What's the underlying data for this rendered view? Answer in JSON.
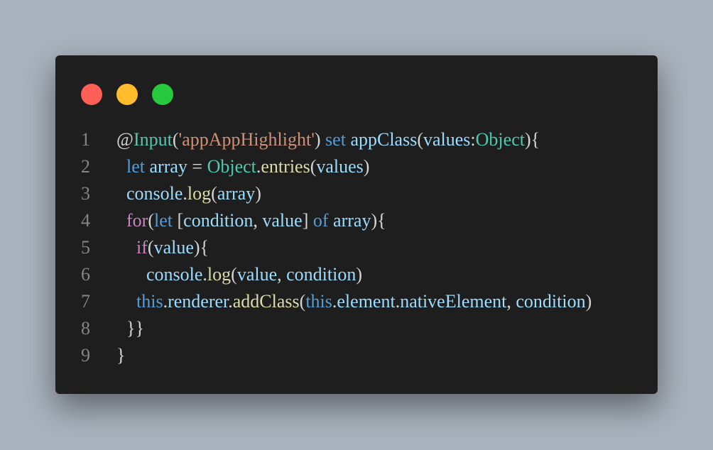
{
  "window": {
    "lights": [
      {
        "name": "close",
        "color": "#ff5f56"
      },
      {
        "name": "minimize",
        "color": "#ffbd2e"
      },
      {
        "name": "zoom",
        "color": "#27c93f"
      }
    ]
  },
  "colors": {
    "background": "#a9b3bd",
    "editor": "#1e1e1e",
    "plain": "#d4d4d4",
    "line_number": "#858585",
    "keyword": "#569cd6",
    "control": "#c586c0",
    "type": "#4ec9b0",
    "string": "#ce9178",
    "variable": "#9cdcfe",
    "function": "#dcdcaa"
  },
  "code": {
    "lines": [
      {
        "number": "1",
        "indent": 0,
        "tokens": [
          {
            "t": "@",
            "c": "plain"
          },
          {
            "t": "Input",
            "c": "type"
          },
          {
            "t": "(",
            "c": "plain"
          },
          {
            "t": "'appAppHighlight'",
            "c": "string"
          },
          {
            "t": ") ",
            "c": "plain"
          },
          {
            "t": "set",
            "c": "keyword"
          },
          {
            "t": " ",
            "c": "plain"
          },
          {
            "t": "appClass",
            "c": "variable"
          },
          {
            "t": "(",
            "c": "plain"
          },
          {
            "t": "values",
            "c": "variable"
          },
          {
            "t": ":",
            "c": "plain"
          },
          {
            "t": "Object",
            "c": "type"
          },
          {
            "t": "){",
            "c": "plain"
          }
        ]
      },
      {
        "number": "2",
        "indent": 1,
        "tokens": [
          {
            "t": "let",
            "c": "keyword"
          },
          {
            "t": " ",
            "c": "plain"
          },
          {
            "t": "array",
            "c": "variable"
          },
          {
            "t": " = ",
            "c": "plain"
          },
          {
            "t": "Object",
            "c": "type"
          },
          {
            "t": ".",
            "c": "plain"
          },
          {
            "t": "entries",
            "c": "function"
          },
          {
            "t": "(",
            "c": "plain"
          },
          {
            "t": "values",
            "c": "variable"
          },
          {
            "t": ")",
            "c": "plain"
          }
        ]
      },
      {
        "number": "3",
        "indent": 1,
        "tokens": [
          {
            "t": "console",
            "c": "variable"
          },
          {
            "t": ".",
            "c": "plain"
          },
          {
            "t": "log",
            "c": "function"
          },
          {
            "t": "(",
            "c": "plain"
          },
          {
            "t": "array",
            "c": "variable"
          },
          {
            "t": ")",
            "c": "plain"
          }
        ]
      },
      {
        "number": "4",
        "indent": 1,
        "tokens": [
          {
            "t": "for",
            "c": "control"
          },
          {
            "t": "(",
            "c": "plain"
          },
          {
            "t": "let",
            "c": "keyword"
          },
          {
            "t": " [",
            "c": "plain"
          },
          {
            "t": "condition",
            "c": "variable"
          },
          {
            "t": ", ",
            "c": "plain"
          },
          {
            "t": "value",
            "c": "variable"
          },
          {
            "t": "] ",
            "c": "plain"
          },
          {
            "t": "of",
            "c": "keyword"
          },
          {
            "t": " ",
            "c": "plain"
          },
          {
            "t": "array",
            "c": "variable"
          },
          {
            "t": "){",
            "c": "plain"
          }
        ]
      },
      {
        "number": "5",
        "indent": 2,
        "tokens": [
          {
            "t": "if",
            "c": "control"
          },
          {
            "t": "(",
            "c": "plain"
          },
          {
            "t": "value",
            "c": "variable"
          },
          {
            "t": "){",
            "c": "plain"
          }
        ]
      },
      {
        "number": "6",
        "indent": 3,
        "tokens": [
          {
            "t": "console",
            "c": "variable"
          },
          {
            "t": ".",
            "c": "plain"
          },
          {
            "t": "log",
            "c": "function"
          },
          {
            "t": "(",
            "c": "plain"
          },
          {
            "t": "value",
            "c": "variable"
          },
          {
            "t": ", ",
            "c": "plain"
          },
          {
            "t": "condition",
            "c": "variable"
          },
          {
            "t": ")",
            "c": "plain"
          }
        ]
      },
      {
        "number": "7",
        "indent": 2,
        "tokens": [
          {
            "t": "this",
            "c": "keyword"
          },
          {
            "t": ".",
            "c": "plain"
          },
          {
            "t": "renderer",
            "c": "variable"
          },
          {
            "t": ".",
            "c": "plain"
          },
          {
            "t": "addClass",
            "c": "function"
          },
          {
            "t": "(",
            "c": "plain"
          },
          {
            "t": "this",
            "c": "keyword"
          },
          {
            "t": ".",
            "c": "plain"
          },
          {
            "t": "element",
            "c": "variable"
          },
          {
            "t": ".",
            "c": "plain"
          },
          {
            "t": "nativeElement",
            "c": "variable"
          },
          {
            "t": ", ",
            "c": "plain"
          },
          {
            "t": "condition",
            "c": "variable"
          },
          {
            "t": ")",
            "c": "plain"
          }
        ]
      },
      {
        "number": "8",
        "indent": 1,
        "tokens": [
          {
            "t": "}}",
            "c": "plain"
          }
        ]
      },
      {
        "number": "9",
        "indent": 0,
        "tokens": [
          {
            "t": "}",
            "c": "plain"
          }
        ]
      }
    ]
  }
}
